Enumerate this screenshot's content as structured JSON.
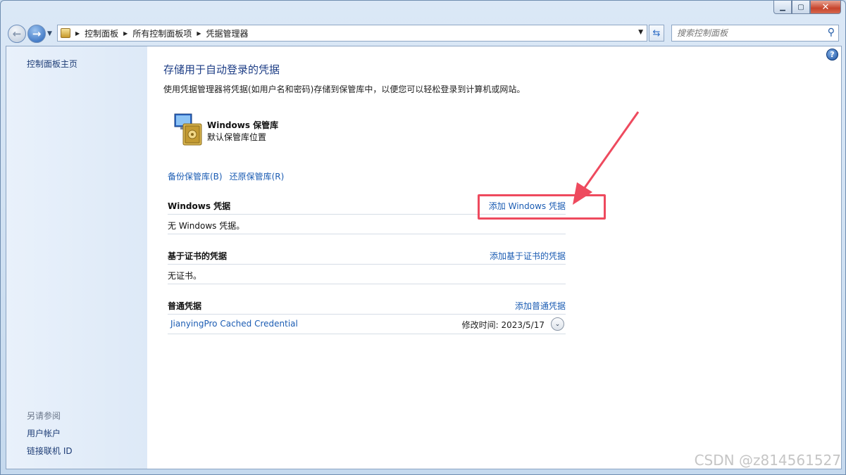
{
  "window": {
    "minimize_icon": "minimize-icon",
    "maximize_icon": "maximize-icon",
    "close_icon": "close-icon"
  },
  "nav": {
    "breadcrumbs": [
      "控制面板",
      "所有控制面板项",
      "凭据管理器"
    ],
    "search_placeholder": "搜索控制面板"
  },
  "sidebar": {
    "home": "控制面板主页",
    "see_also": "另请参阅",
    "links": [
      "用户帐户",
      "链接联机 ID"
    ]
  },
  "main": {
    "title": "存储用于自动登录的凭据",
    "description": "使用凭据管理器将凭据(如用户名和密码)存储到保管库中，以便您可以轻松登录到计算机或网站。",
    "vault": {
      "name": "Windows 保管库",
      "subtitle": "默认保管库位置",
      "backup_link": "备份保管库(B)",
      "restore_link": "还原保管库(R)"
    },
    "sections": {
      "windows": {
        "title": "Windows 凭据",
        "add_link": "添加 Windows 凭据",
        "empty": "无 Windows 凭据。"
      },
      "certificate": {
        "title": "基于证书的凭据",
        "add_link": "添加基于证书的凭据",
        "empty": "无证书。"
      },
      "generic": {
        "title": "普通凭据",
        "add_link": "添加普通凭据",
        "items": [
          {
            "name": "JianyingPro Cached Credential",
            "modified": "修改时间:  2023/5/17"
          }
        ]
      }
    }
  },
  "annotation": {
    "color": "#ee4a5e"
  },
  "watermark": "CSDN @z814561527"
}
